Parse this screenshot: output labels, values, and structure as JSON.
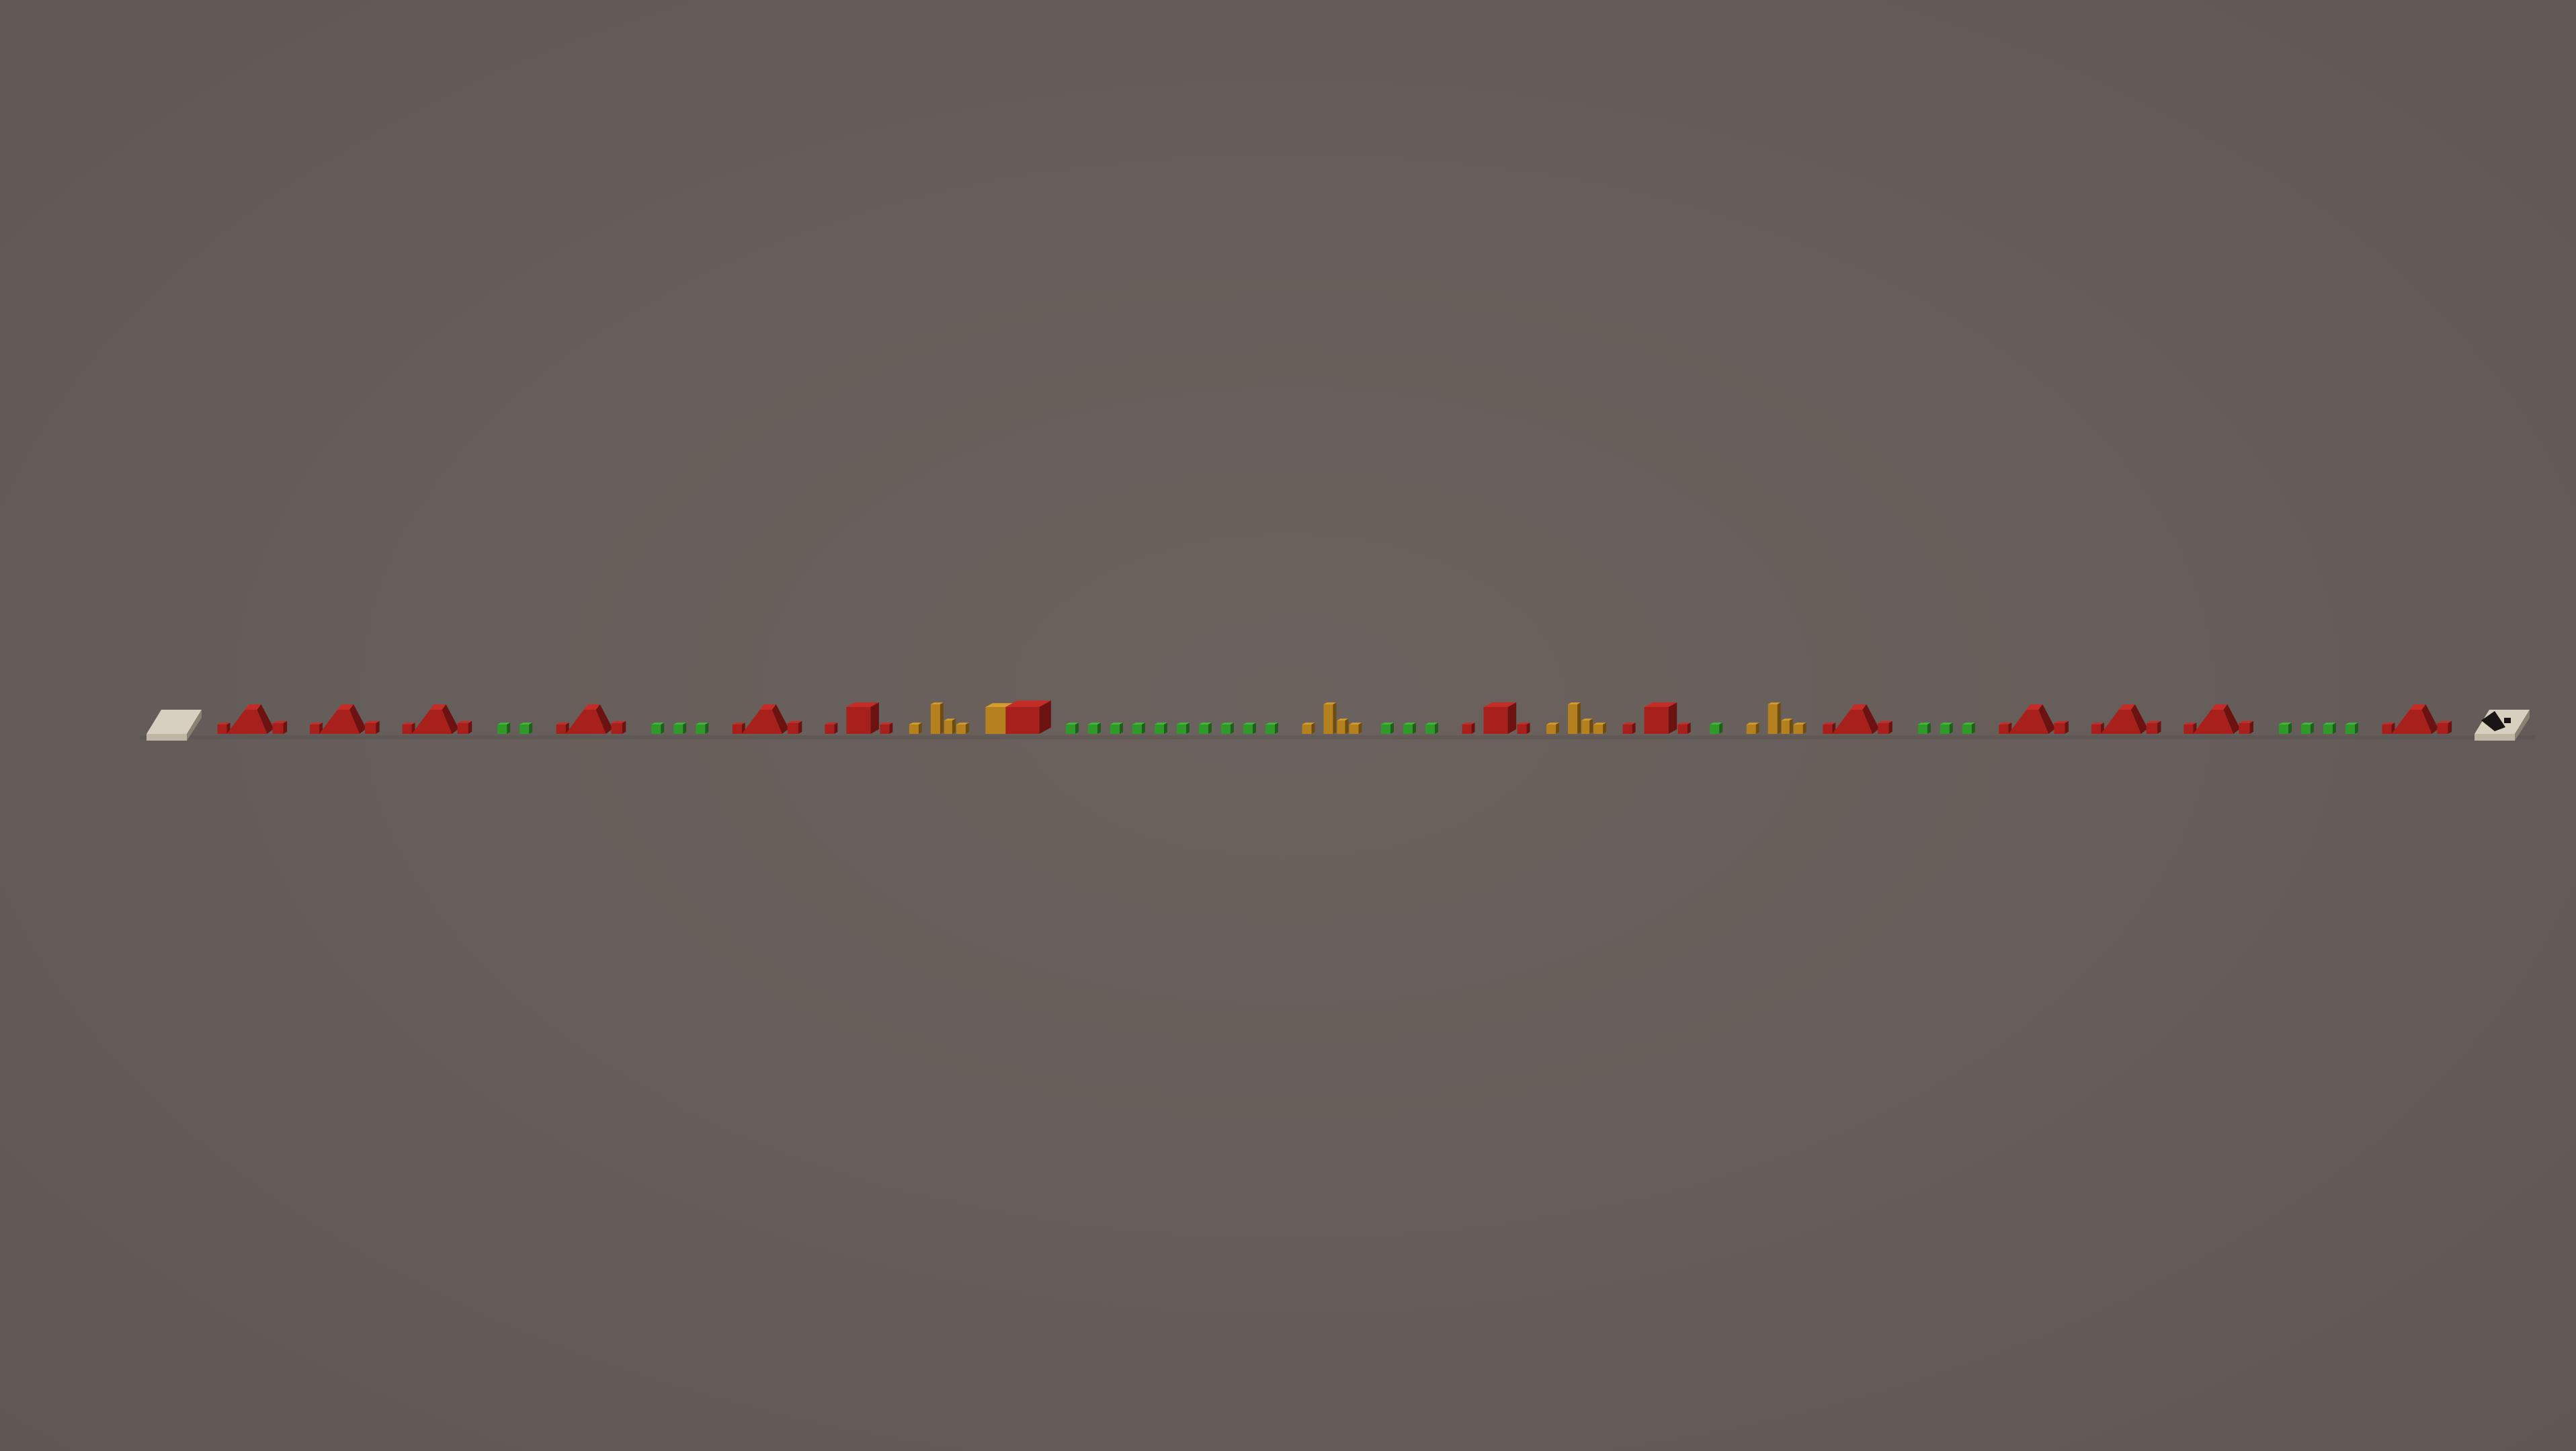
{
  "scene": {
    "description_type": "3d-level-strip",
    "background_color": "#675f5b"
  },
  "palette": {
    "red": "#a8201c",
    "red_top": "#c42d27",
    "red_side": "#6c1311",
    "green": "#2f9a2a",
    "green_top": "#45b73c",
    "green_side": "#1d5e1a",
    "amber": "#b5801e",
    "amber_top": "#d49d2e",
    "amber_side": "#6e4c10",
    "stone": "#bfb6a6",
    "stone_top": "#d7cfbf",
    "stone_side": "#8a8173",
    "dark": "#1a1414"
  },
  "course": {
    "start_marker": "start-pad",
    "finish_marker": "finish-pad",
    "segments": [
      {
        "kind": "start-pad",
        "color": "stone"
      },
      {
        "kind": "obstacle-cluster",
        "color": "red",
        "shape": "ramp-pair"
      },
      {
        "kind": "obstacle-cluster",
        "color": "red",
        "shape": "ramp-pair"
      },
      {
        "kind": "obstacle-cluster",
        "color": "red",
        "shape": "ramp-pair"
      },
      {
        "kind": "pickup-row",
        "color": "green",
        "count": 2
      },
      {
        "kind": "obstacle-cluster",
        "color": "red",
        "shape": "ramp-pair"
      },
      {
        "kind": "pickup-row",
        "color": "green",
        "count": 3
      },
      {
        "kind": "obstacle-cluster",
        "color": "red",
        "shape": "ramp-pair"
      },
      {
        "kind": "obstacle-cluster",
        "color": "red",
        "shape": "block-pair"
      },
      {
        "kind": "obstacle-cluster",
        "color": "amber",
        "shape": "spire"
      },
      {
        "kind": "checkpoint-block",
        "color": "red"
      },
      {
        "kind": "pickup-row",
        "color": "green",
        "count": 10
      },
      {
        "kind": "obstacle-cluster",
        "color": "amber",
        "shape": "spire"
      },
      {
        "kind": "pickup-row",
        "color": "green",
        "count": 3
      },
      {
        "kind": "obstacle-cluster",
        "color": "red",
        "shape": "block-pair"
      },
      {
        "kind": "obstacle-cluster",
        "color": "amber",
        "shape": "spire"
      },
      {
        "kind": "obstacle-cluster",
        "color": "red",
        "shape": "block-pair"
      },
      {
        "kind": "pickup-row",
        "color": "green",
        "count": 1
      },
      {
        "kind": "obstacle-cluster",
        "color": "amber",
        "shape": "spire"
      },
      {
        "kind": "obstacle-cluster",
        "color": "red",
        "shape": "ramp-pair"
      },
      {
        "kind": "pickup-row",
        "color": "green",
        "count": 3
      },
      {
        "kind": "obstacle-cluster",
        "color": "red",
        "shape": "ramp-pair"
      },
      {
        "kind": "obstacle-cluster",
        "color": "red",
        "shape": "ramp-pair"
      },
      {
        "kind": "obstacle-cluster",
        "color": "red",
        "shape": "ramp-pair"
      },
      {
        "kind": "pickup-row",
        "color": "green",
        "count": 4
      },
      {
        "kind": "obstacle-cluster",
        "color": "red",
        "shape": "ramp-pair"
      },
      {
        "kind": "finish-pad",
        "color": "stone"
      }
    ]
  }
}
